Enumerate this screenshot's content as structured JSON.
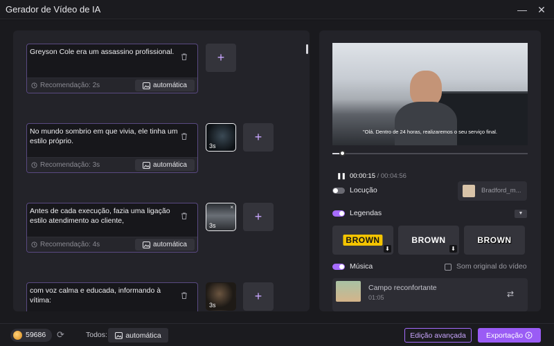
{
  "window": {
    "title": "Gerador de Vídeo de IA",
    "minimize_glyph": "—",
    "close_glyph": "✕"
  },
  "scenes": [
    {
      "text": "Greyson Cole era um assassino profissional.",
      "recommendation": "Recomendação: 2s",
      "auto_label": "automática",
      "add_glyph": "+"
    },
    {
      "text": "No mundo sombrio em que vivia, ele tinha um estilo próprio.",
      "recommendation": "Recomendação: 3s",
      "auto_label": "automática",
      "thumb_duration": "3s",
      "add_glyph": "+"
    },
    {
      "text": "Antes de cada execução, fazia uma ligação estilo atendimento ao cliente,",
      "recommendation": "Recomendação: 4s",
      "auto_label": "automática",
      "thumb_duration": "3s",
      "thumb_close": "×",
      "add_glyph": "+"
    },
    {
      "text": "com voz calma e educada, informando à vítima:",
      "thumb_duration": "3s",
      "add_glyph": "+"
    }
  ],
  "preview": {
    "caption": "\"Olá. Dentro de 24 horas, realizaremos o seu serviço final.",
    "current_time": "00:00:15",
    "total_time": "/ 00:04:56",
    "progress": 0.05,
    "pause_glyph": "❚❚"
  },
  "narration": {
    "label": "Locução",
    "enabled": false,
    "voice_name": "Bradford_m..."
  },
  "subtitles": {
    "label": "Legendas",
    "enabled": true,
    "dropdown_glyph": "▼",
    "styles": [
      {
        "sample": "BROWN",
        "downloadable": true
      },
      {
        "sample": "BROWN",
        "downloadable": true
      },
      {
        "sample": "BROWN",
        "downloadable": false
      }
    ],
    "download_glyph": "⬇"
  },
  "music": {
    "label": "Música",
    "enabled": true,
    "original_sound_label": "Som original do vídeo",
    "original_sound_checked": false,
    "track_title": "Campo reconfortante",
    "track_duration": "01:05",
    "swap_glyph": "⇄"
  },
  "footer": {
    "credits": "59686",
    "all_label": "Todos:",
    "all_auto_label": "automática",
    "advanced_edit_label": "Edição avançada",
    "export_label": "Exportação"
  },
  "colors": {
    "accent": "#9a5cf5",
    "accent_light": "#c9a6ff",
    "card_border": "#5a4a82",
    "panel": "#232329",
    "background": "#1a1a1e"
  },
  "icons": [
    "trash-icon",
    "clock-icon",
    "image-auto-icon",
    "plus-icon",
    "pause-icon",
    "refresh-icon",
    "swap-icon",
    "download-icon",
    "coin-icon"
  ]
}
